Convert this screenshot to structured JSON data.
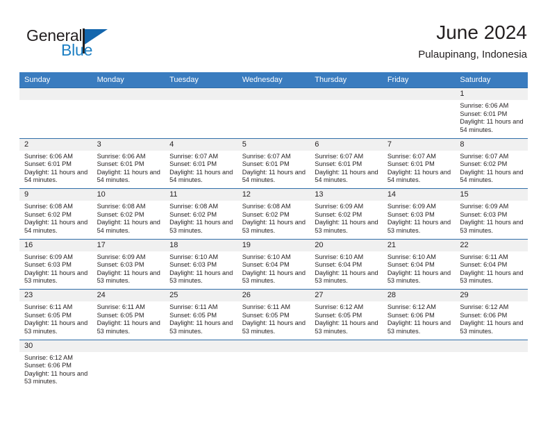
{
  "brand": {
    "name_top": "General",
    "name_bottom": "Blue",
    "logo_icon": "triangle-flag-icon",
    "color_dark": "#231f20",
    "color_blue": "#1d7fc3"
  },
  "header": {
    "title": "June 2024",
    "subtitle": "Pulaupinang, Indonesia"
  },
  "theme": {
    "header_blue": "#3a7cbf",
    "row_divider": "#2f6da8",
    "day_band_gray": "#f0f0f0"
  },
  "weekdays": [
    "Sunday",
    "Monday",
    "Tuesday",
    "Wednesday",
    "Thursday",
    "Friday",
    "Saturday"
  ],
  "weeks": [
    [
      {
        "day": "",
        "empty": true
      },
      {
        "day": "",
        "empty": true
      },
      {
        "day": "",
        "empty": true
      },
      {
        "day": "",
        "empty": true
      },
      {
        "day": "",
        "empty": true
      },
      {
        "day": "",
        "empty": true
      },
      {
        "day": "1",
        "sunrise": "Sunrise: 6:06 AM",
        "sunset": "Sunset: 6:01 PM",
        "daylight": "Daylight: 11 hours and 54 minutes."
      }
    ],
    [
      {
        "day": "2",
        "sunrise": "Sunrise: 6:06 AM",
        "sunset": "Sunset: 6:01 PM",
        "daylight": "Daylight: 11 hours and 54 minutes."
      },
      {
        "day": "3",
        "sunrise": "Sunrise: 6:06 AM",
        "sunset": "Sunset: 6:01 PM",
        "daylight": "Daylight: 11 hours and 54 minutes."
      },
      {
        "day": "4",
        "sunrise": "Sunrise: 6:07 AM",
        "sunset": "Sunset: 6:01 PM",
        "daylight": "Daylight: 11 hours and 54 minutes."
      },
      {
        "day": "5",
        "sunrise": "Sunrise: 6:07 AM",
        "sunset": "Sunset: 6:01 PM",
        "daylight": "Daylight: 11 hours and 54 minutes."
      },
      {
        "day": "6",
        "sunrise": "Sunrise: 6:07 AM",
        "sunset": "Sunset: 6:01 PM",
        "daylight": "Daylight: 11 hours and 54 minutes."
      },
      {
        "day": "7",
        "sunrise": "Sunrise: 6:07 AM",
        "sunset": "Sunset: 6:01 PM",
        "daylight": "Daylight: 11 hours and 54 minutes."
      },
      {
        "day": "8",
        "sunrise": "Sunrise: 6:07 AM",
        "sunset": "Sunset: 6:02 PM",
        "daylight": "Daylight: 11 hours and 54 minutes."
      }
    ],
    [
      {
        "day": "9",
        "sunrise": "Sunrise: 6:08 AM",
        "sunset": "Sunset: 6:02 PM",
        "daylight": "Daylight: 11 hours and 54 minutes."
      },
      {
        "day": "10",
        "sunrise": "Sunrise: 6:08 AM",
        "sunset": "Sunset: 6:02 PM",
        "daylight": "Daylight: 11 hours and 54 minutes."
      },
      {
        "day": "11",
        "sunrise": "Sunrise: 6:08 AM",
        "sunset": "Sunset: 6:02 PM",
        "daylight": "Daylight: 11 hours and 53 minutes."
      },
      {
        "day": "12",
        "sunrise": "Sunrise: 6:08 AM",
        "sunset": "Sunset: 6:02 PM",
        "daylight": "Daylight: 11 hours and 53 minutes."
      },
      {
        "day": "13",
        "sunrise": "Sunrise: 6:09 AM",
        "sunset": "Sunset: 6:02 PM",
        "daylight": "Daylight: 11 hours and 53 minutes."
      },
      {
        "day": "14",
        "sunrise": "Sunrise: 6:09 AM",
        "sunset": "Sunset: 6:03 PM",
        "daylight": "Daylight: 11 hours and 53 minutes."
      },
      {
        "day": "15",
        "sunrise": "Sunrise: 6:09 AM",
        "sunset": "Sunset: 6:03 PM",
        "daylight": "Daylight: 11 hours and 53 minutes."
      }
    ],
    [
      {
        "day": "16",
        "sunrise": "Sunrise: 6:09 AM",
        "sunset": "Sunset: 6:03 PM",
        "daylight": "Daylight: 11 hours and 53 minutes."
      },
      {
        "day": "17",
        "sunrise": "Sunrise: 6:09 AM",
        "sunset": "Sunset: 6:03 PM",
        "daylight": "Daylight: 11 hours and 53 minutes."
      },
      {
        "day": "18",
        "sunrise": "Sunrise: 6:10 AM",
        "sunset": "Sunset: 6:03 PM",
        "daylight": "Daylight: 11 hours and 53 minutes."
      },
      {
        "day": "19",
        "sunrise": "Sunrise: 6:10 AM",
        "sunset": "Sunset: 6:04 PM",
        "daylight": "Daylight: 11 hours and 53 minutes."
      },
      {
        "day": "20",
        "sunrise": "Sunrise: 6:10 AM",
        "sunset": "Sunset: 6:04 PM",
        "daylight": "Daylight: 11 hours and 53 minutes."
      },
      {
        "day": "21",
        "sunrise": "Sunrise: 6:10 AM",
        "sunset": "Sunset: 6:04 PM",
        "daylight": "Daylight: 11 hours and 53 minutes."
      },
      {
        "day": "22",
        "sunrise": "Sunrise: 6:11 AM",
        "sunset": "Sunset: 6:04 PM",
        "daylight": "Daylight: 11 hours and 53 minutes."
      }
    ],
    [
      {
        "day": "23",
        "sunrise": "Sunrise: 6:11 AM",
        "sunset": "Sunset: 6:05 PM",
        "daylight": "Daylight: 11 hours and 53 minutes."
      },
      {
        "day": "24",
        "sunrise": "Sunrise: 6:11 AM",
        "sunset": "Sunset: 6:05 PM",
        "daylight": "Daylight: 11 hours and 53 minutes."
      },
      {
        "day": "25",
        "sunrise": "Sunrise: 6:11 AM",
        "sunset": "Sunset: 6:05 PM",
        "daylight": "Daylight: 11 hours and 53 minutes."
      },
      {
        "day": "26",
        "sunrise": "Sunrise: 6:11 AM",
        "sunset": "Sunset: 6:05 PM",
        "daylight": "Daylight: 11 hours and 53 minutes."
      },
      {
        "day": "27",
        "sunrise": "Sunrise: 6:12 AM",
        "sunset": "Sunset: 6:05 PM",
        "daylight": "Daylight: 11 hours and 53 minutes."
      },
      {
        "day": "28",
        "sunrise": "Sunrise: 6:12 AM",
        "sunset": "Sunset: 6:06 PM",
        "daylight": "Daylight: 11 hours and 53 minutes."
      },
      {
        "day": "29",
        "sunrise": "Sunrise: 6:12 AM",
        "sunset": "Sunset: 6:06 PM",
        "daylight": "Daylight: 11 hours and 53 minutes."
      }
    ],
    [
      {
        "day": "30",
        "sunrise": "Sunrise: 6:12 AM",
        "sunset": "Sunset: 6:06 PM",
        "daylight": "Daylight: 11 hours and 53 minutes."
      },
      {
        "day": "",
        "empty": true
      },
      {
        "day": "",
        "empty": true
      },
      {
        "day": "",
        "empty": true
      },
      {
        "day": "",
        "empty": true
      },
      {
        "day": "",
        "empty": true
      },
      {
        "day": "",
        "empty": true
      }
    ]
  ]
}
